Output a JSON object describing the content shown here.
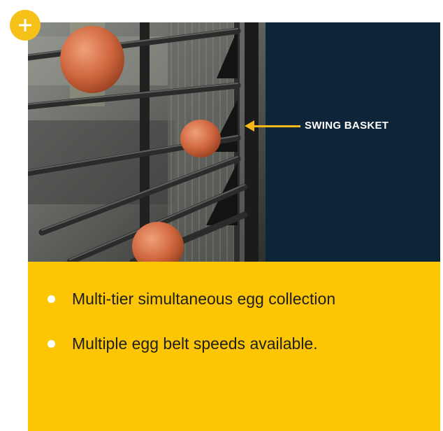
{
  "callout": {
    "label": "SWING BASKET"
  },
  "features": [
    {
      "text": "Multi-tier simultaneous egg collection"
    },
    {
      "text": "Multiple egg belt speeds available."
    }
  ],
  "colors": {
    "navy": "#0e2438",
    "yellow": "#fcc604",
    "accent": "#f4b81b",
    "bullet": "#ffffff"
  },
  "icons": {
    "expand": "plus-icon",
    "callout_arrow": "arrow-left-icon",
    "bullet": "bullet-dot-icon"
  }
}
